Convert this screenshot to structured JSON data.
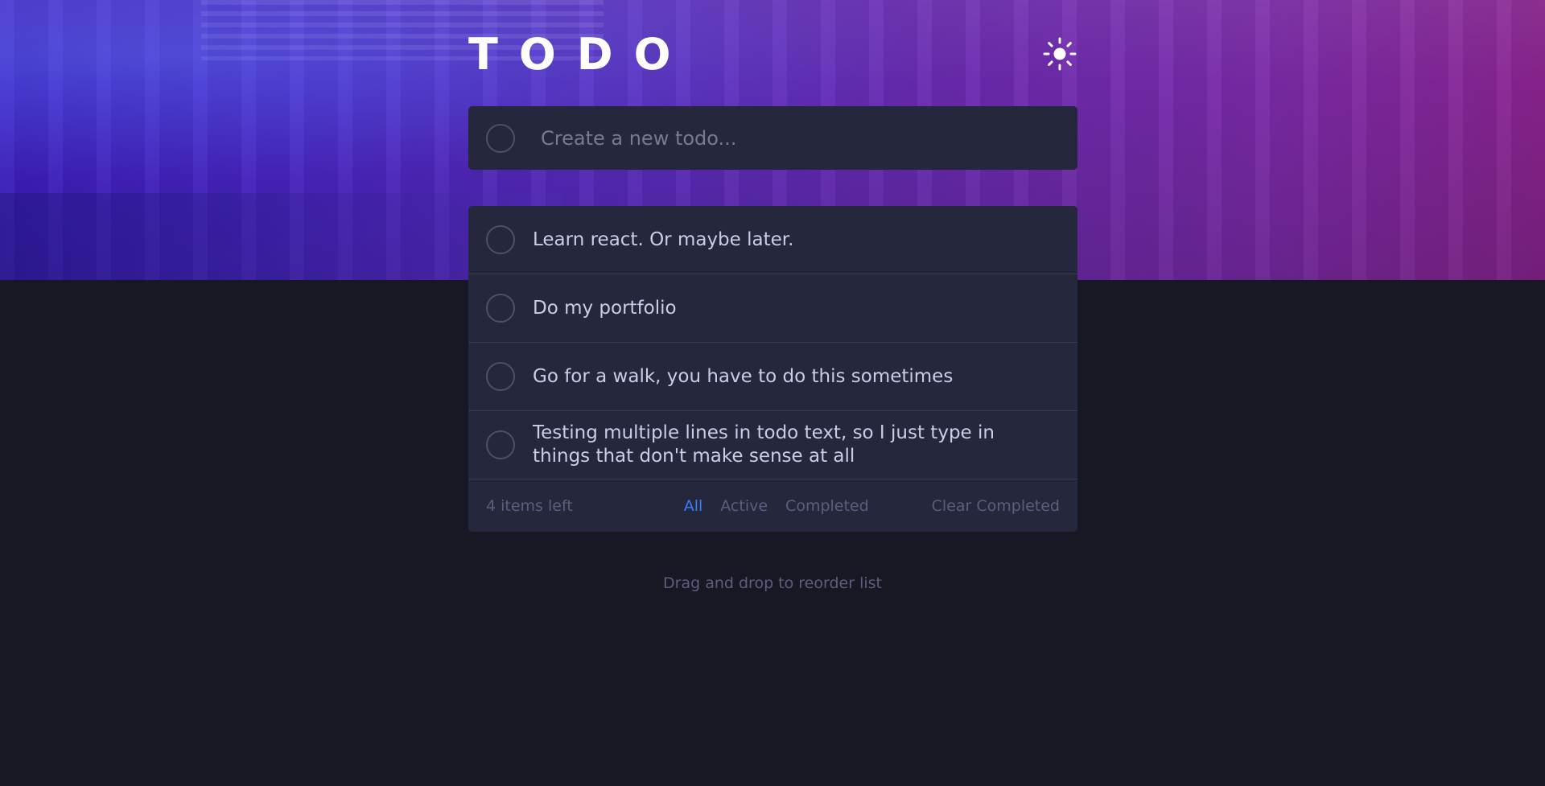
{
  "header": {
    "title": "TODO",
    "theme_icon": "sun-icon"
  },
  "new_todo": {
    "placeholder": "Create a new todo...",
    "value": ""
  },
  "todos": [
    {
      "text": "Learn react. Or maybe later.",
      "completed": false
    },
    {
      "text": "Do my portfolio",
      "completed": false
    },
    {
      "text": "Go for a walk, you have to do this sometimes",
      "completed": false
    },
    {
      "text": "Testing multiple lines in todo text, so I just type in things that don't make sense at all",
      "completed": false
    }
  ],
  "footer": {
    "items_left": "4 items left",
    "filters": {
      "all": "All",
      "active": "Active",
      "completed": "Completed"
    },
    "selected_filter": "All",
    "clear_label": "Clear Completed"
  },
  "hint": "Drag and drop to reorder list",
  "colors": {
    "background": "#181824",
    "card": "#25273c",
    "text": "#cacde8",
    "muted": "#5b5e7e",
    "accent": "#3a7cfd",
    "gradient_start": "#3f1fc4",
    "gradient_end": "#8a2490"
  }
}
